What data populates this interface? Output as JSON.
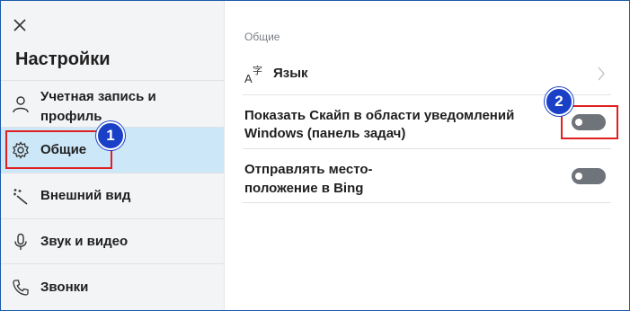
{
  "sidebar": {
    "title": "Настройки",
    "items": [
      {
        "label_line1": "Учетная запись и",
        "label_line2": "профиль",
        "icon": "person-icon"
      },
      {
        "label": "Общие",
        "icon": "gear-icon",
        "active": true
      },
      {
        "label": "Внешний вид",
        "icon": "magic-wand-icon"
      },
      {
        "label": "Звук и видео",
        "icon": "microphone-icon"
      },
      {
        "label": "Звонки",
        "icon": "phone-icon"
      }
    ]
  },
  "main": {
    "section_title": "Общие",
    "language": {
      "label": "Язык",
      "icon": "language-icon"
    },
    "settings": [
      {
        "line1": "Показать Скайп в области уведомлений",
        "line2": "Windows (панель задач)",
        "enabled": false
      },
      {
        "line1": "Отправлять место-",
        "line2": "положение в Bing",
        "enabled": false
      }
    ]
  },
  "annotations": {
    "badge1": "1",
    "badge2": "2"
  },
  "colors": {
    "accent_blue": "#1a40c8",
    "highlight_red": "#e02020",
    "active_item_bg": "#cce7f8",
    "toggle_off": "#6f747a"
  }
}
